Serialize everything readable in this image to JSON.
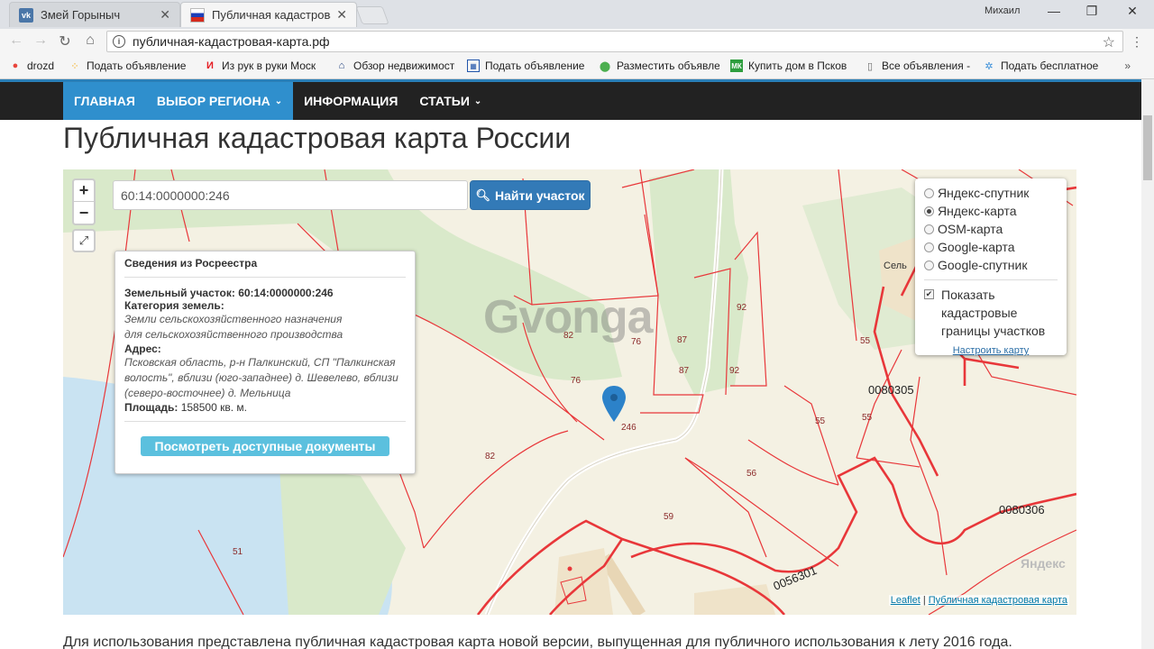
{
  "browser": {
    "tabs": [
      {
        "title": "Змей Горыныч",
        "icon": "vk-icon"
      },
      {
        "title": "Публичная кадастровая",
        "icon": "russia-flag-icon"
      }
    ],
    "user": "Михаил",
    "url": "публичная-кадастровая-карта.рф",
    "bookmarks": [
      {
        "label": "drozd",
        "icon": "apps-icon"
      },
      {
        "label": "Подать объявление",
        "icon": "dots-icon"
      },
      {
        "label": "Из рук в руки Моск",
        "icon": "irr-icon"
      },
      {
        "label": "Обзор недвижимост",
        "icon": "house-icon"
      },
      {
        "label": "Подать объявление",
        "icon": "grid-icon"
      },
      {
        "label": "Разместить объявле",
        "icon": "pin-icon"
      },
      {
        "label": "Купить дом в Псков",
        "icon": "mk-icon"
      },
      {
        "label": "Все объявления -",
        "icon": "page-icon"
      },
      {
        "label": "Подать бесплатное",
        "icon": "star-icon"
      }
    ],
    "bookmarks_more": "»"
  },
  "site": {
    "nav": [
      {
        "label": "ГЛАВНАЯ",
        "active": true
      },
      {
        "label": "ВЫБОР РЕГИОНА",
        "active": true,
        "dropdown": true
      },
      {
        "label": "ИНФОРМАЦИЯ",
        "active": false
      },
      {
        "label": "СТАТЬИ",
        "active": false,
        "dropdown": true
      }
    ],
    "caret": "⌄",
    "title": "Публичная кадастровая карта России",
    "bottom_text": "Для использования представлена публичная кадастровая карта новой версии, выпущенная для публичного использования к лету 2016 года."
  },
  "map": {
    "zoom_in": "+",
    "zoom_out": "−",
    "search_value": "60:14:0000000:246",
    "search_button": "Найти участок",
    "info": {
      "header": "Сведения из Росреестра",
      "parcel_label": "Земельный участок:",
      "parcel_value": "60:14:0000000:246",
      "category_label": "Категория земель:",
      "category_value": "Земли сельскохозяйственного назначения для сельскохозяйственного производства",
      "address_label": "Адрес:",
      "address_value": "Псковская область, р-н Палкинский, СП \"Палкинская волость\", вблизи (юго-западнее) д. Шевелево, вблизи (северо-восточнее) д. Мельница",
      "area_label": "Площадь:",
      "area_value": "158500 кв. м.",
      "docs_button": "Посмотреть доступные документы"
    },
    "layers": {
      "options": [
        {
          "label": "Яндекс-спутник",
          "selected": false
        },
        {
          "label": "Яндекс-карта",
          "selected": true
        },
        {
          "label": "OSM-карта",
          "selected": false
        },
        {
          "label": "Google-карта",
          "selected": false
        },
        {
          "label": "Google-спутник",
          "selected": false
        }
      ],
      "show_cadastral_label": "Показать кадастровые границы участков",
      "show_cadastral_checked": true,
      "configure_link": "Настроить карту"
    },
    "parcel_labels": [
      "82",
      "76",
      "87",
      "92",
      "87",
      "92",
      "76",
      "246",
      "82",
      "55",
      "55",
      "0080305",
      "55",
      "56",
      "59",
      "0080306",
      "51",
      "0056301",
      "Сель"
    ],
    "watermark": "Gvonga",
    "yandex_logo": "Яндекс",
    "attribution": {
      "leaflet": "Leaflet",
      "separator": " | ",
      "source": "Публичная кадастровая карта"
    },
    "colors": {
      "boundary": "#e8373a",
      "forest": "#d8e8c8",
      "water": "#c9e3f2",
      "marker": "#2c82c9"
    }
  }
}
